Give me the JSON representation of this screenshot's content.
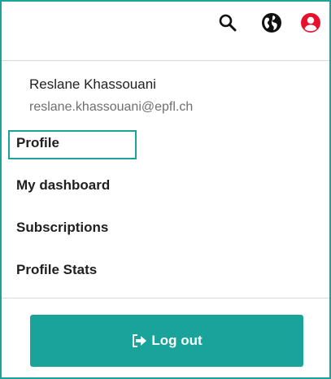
{
  "header": {
    "icons": [
      "search-icon",
      "globe-icon",
      "user-icon"
    ],
    "user_icon_color": "#e8112d"
  },
  "user": {
    "name": "Reslane Khassouani",
    "email": "reslane.khassouani@epfl.ch"
  },
  "menu": {
    "items": [
      {
        "label": "Profile",
        "focused": true
      },
      {
        "label": "My dashboard"
      },
      {
        "label": "Subscriptions"
      },
      {
        "label": "Profile Stats"
      }
    ]
  },
  "logout": {
    "label": "Log out",
    "icon": "logout-icon"
  },
  "colors": {
    "accent": "#1aa39a",
    "text": "#1f1f1f",
    "muted": "#6f6f6f"
  }
}
